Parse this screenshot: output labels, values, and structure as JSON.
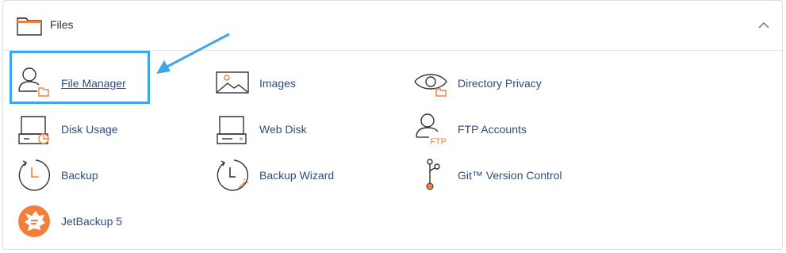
{
  "header": {
    "title": "Files",
    "folder_icon": "folder-icon",
    "collapse_icon": "chevron-up-icon"
  },
  "tools": {
    "file_manager": {
      "label": "File Manager",
      "icon": "file-manager-icon"
    },
    "images": {
      "label": "Images",
      "icon": "images-icon"
    },
    "directory_privacy": {
      "label": "Directory Privacy",
      "icon": "directory-privacy-icon"
    },
    "disk_usage": {
      "label": "Disk Usage",
      "icon": "disk-usage-icon"
    },
    "web_disk": {
      "label": "Web Disk",
      "icon": "web-disk-icon"
    },
    "ftp_accounts": {
      "label": "FTP Accounts",
      "icon": "ftp-accounts-icon",
      "icon_text": "FTP"
    },
    "backup": {
      "label": "Backup",
      "icon": "backup-icon"
    },
    "backup_wizard": {
      "label": "Backup Wizard",
      "icon": "backup-wizard-icon"
    },
    "git": {
      "label": "Git™ Version Control",
      "icon": "git-icon"
    },
    "jetbackup": {
      "label": "JetBackup 5",
      "icon": "jetbackup-icon"
    }
  },
  "colors": {
    "accent": "#f0803c",
    "link": "#2c4d7f",
    "highlight": "#3ea6ea",
    "icon_stroke": "#333333"
  }
}
